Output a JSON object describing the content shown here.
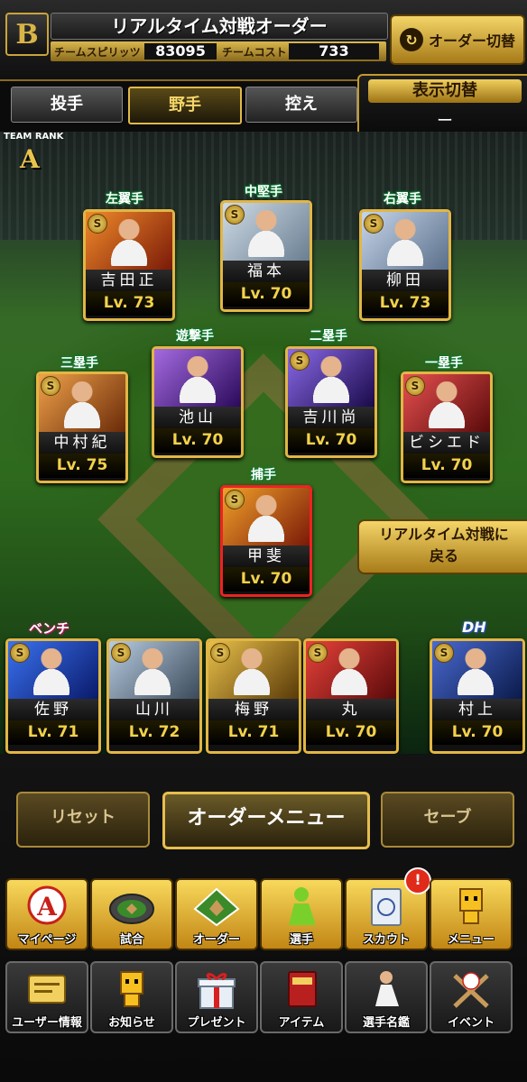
{
  "header": {
    "logo_letter": "B",
    "title": "リアルタイム対戦オーダー",
    "team_spirit_label": "チームスピリッツ",
    "team_spirit_value": "83095",
    "team_cost_label": "チームコスト",
    "team_cost_value": "733",
    "order_switch_label": "オーダー切替",
    "order_switch_icon": "↻"
  },
  "tabs": [
    {
      "label": "投手",
      "active": false
    },
    {
      "label": "野手",
      "active": true
    },
    {
      "label": "控え",
      "active": false
    }
  ],
  "display_toggle": {
    "title": "表示切替",
    "value": "ー"
  },
  "team_rank": {
    "label": "TEAM RANK",
    "value": "A"
  },
  "positions": {
    "left_field": {
      "pos": "左翼手",
      "name": "吉田正",
      "level": "Lv. 73",
      "badge": "S",
      "color": "#e05a1a"
    },
    "center_field": {
      "pos": "中堅手",
      "name": "福本",
      "level": "Lv. 70",
      "badge": "S",
      "color": "#b0c4d8"
    },
    "right_field": {
      "pos": "右翼手",
      "name": "柳田",
      "level": "Lv. 73",
      "badge": "S",
      "color": "#9ab4d6"
    },
    "shortstop": {
      "pos": "遊撃手",
      "name": "池山",
      "level": "Lv. 70",
      "badge": "S",
      "color": "#7a4ab8"
    },
    "second_base": {
      "pos": "二塁手",
      "name": "吉川尚",
      "level": "Lv. 70",
      "badge": "S",
      "color": "#6a4ad0"
    },
    "third_base": {
      "pos": "三塁手",
      "name": "中村紀",
      "level": "Lv. 75",
      "badge": "S",
      "color": "#d86a2a"
    },
    "first_base": {
      "pos": "一塁手",
      "name": "ビシエド",
      "level": "Lv. 70",
      "badge": "S",
      "color": "#c83232"
    },
    "catcher": {
      "pos": "捕手",
      "name": "甲斐",
      "level": "Lv. 70",
      "badge": "S",
      "color": "#e8741a"
    }
  },
  "return_button": {
    "line1": "リアルタイム対戦に",
    "line2": "戻る"
  },
  "bench": {
    "label": "ベンチ",
    "dh_label": "DH",
    "players": [
      {
        "name": "佐野",
        "level": "Lv. 71",
        "badge": "S",
        "color": "#1a4ad8"
      },
      {
        "name": "山川",
        "level": "Lv. 72",
        "badge": "S",
        "color": "#8ab0d0"
      },
      {
        "name": "梅野",
        "level": "Lv. 71",
        "badge": "S",
        "color": "#d8a21a"
      },
      {
        "name": "丸",
        "level": "Lv. 70",
        "badge": "S",
        "color": "#c8281a"
      },
      {
        "name": "村上",
        "level": "Lv. 70",
        "badge": "S",
        "color": "#3a5ab0"
      }
    ]
  },
  "actions": {
    "reset": "リセット",
    "order_menu": "オーダーメニュー",
    "save": "セーブ"
  },
  "menu_row1": [
    {
      "label": "マイページ",
      "icon": "a-letter-icon"
    },
    {
      "label": "試合",
      "icon": "stadium-icon"
    },
    {
      "label": "オーダー",
      "icon": "field-icon"
    },
    {
      "label": "選手",
      "icon": "player-silhouette-icon"
    },
    {
      "label": "スカウト",
      "icon": "scout-icon"
    },
    {
      "label": "メニュー",
      "icon": "mascot-icon"
    }
  ],
  "menu_row2": [
    {
      "label": "ユーザー情報",
      "icon": "user-info-icon"
    },
    {
      "label": "お知らせ",
      "icon": "mascot-icon"
    },
    {
      "label": "プレゼント",
      "icon": "gift-icon"
    },
    {
      "label": "アイテム",
      "icon": "item-icon"
    },
    {
      "label": "選手名鑑",
      "icon": "player-directory-icon"
    },
    {
      "label": "イベント",
      "icon": "baseball-bats-icon"
    }
  ],
  "scout_notification": "!"
}
